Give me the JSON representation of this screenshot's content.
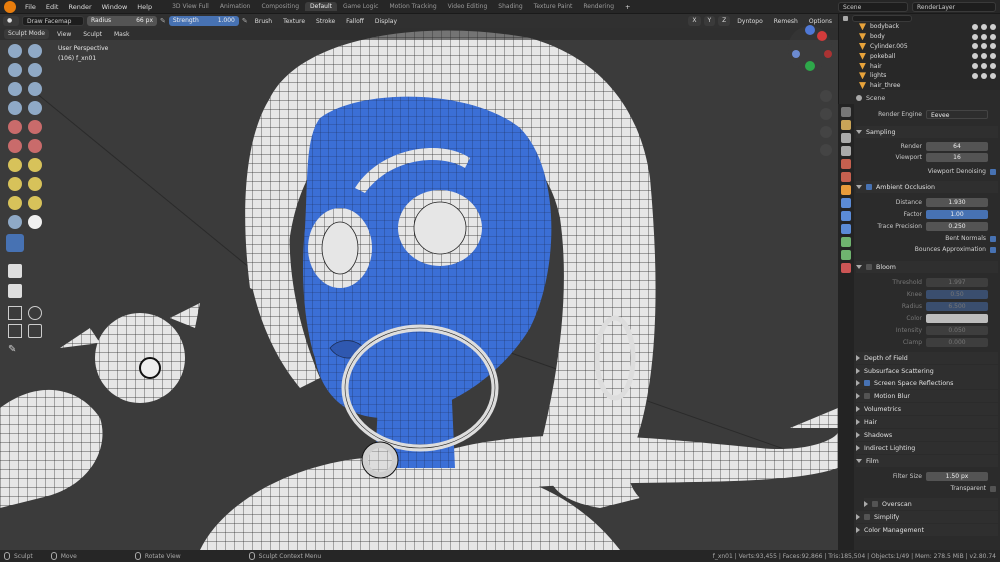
{
  "menu": [
    "File",
    "Edit",
    "Render",
    "Window",
    "Help"
  ],
  "workspaces": [
    "3D View Full",
    "Animation",
    "Compositing",
    "Default",
    "Game Logic",
    "Motion Tracking",
    "Video Editing",
    "Shading",
    "Texture Paint",
    "Rendering"
  ],
  "active_workspace": "Default",
  "scene_label": "Scene",
  "renderlayer_label": "RenderLayer",
  "tool_header": {
    "brush_name": "Draw Facemap",
    "radius_label": "Radius",
    "radius_value": "66 px",
    "strength_label": "Strength",
    "strength_value": "1.000",
    "menus": [
      "Brush",
      "Texture",
      "Stroke",
      "Falloff",
      "Display"
    ],
    "dyntopo": "Dyntopo",
    "remesh": "Remesh",
    "options": "Options"
  },
  "viewport_header": {
    "mode": "Sculpt Mode",
    "menus": [
      "View",
      "Sculpt",
      "Mask"
    ]
  },
  "viewport_overlay": {
    "line1": "User Perspective",
    "line2": "(106) f_xn01"
  },
  "outliner": {
    "rows": [
      "bodyback",
      "body",
      "Cylinder.005",
      "pokeball",
      "hair",
      "lights",
      "hair_three"
    ]
  },
  "properties": {
    "scene": "Scene",
    "render_engine_label": "Render Engine",
    "render_engine": "Eevee",
    "sampling": {
      "title": "Sampling",
      "render_label": "Render",
      "render_value": "64",
      "viewport_label": "Viewport",
      "viewport_value": "16",
      "denoise_label": "Viewport Denoising"
    },
    "ao": {
      "title": "Ambient Occlusion",
      "distance_label": "Distance",
      "distance_value": "1.930",
      "factor_label": "Factor",
      "factor_value": "1.00",
      "trace_label": "Trace Precision",
      "trace_value": "0.250",
      "bent_label": "Bent Normals",
      "bounces_label": "Bounces Approximation"
    },
    "bloom": {
      "title": "Bloom",
      "threshold_label": "Threshold",
      "threshold_value": "1.997",
      "knee_label": "Knee",
      "knee_value": "0.50",
      "radius_label": "Radius",
      "radius_value": "6.500",
      "color_label": "Color",
      "intensity_label": "Intensity",
      "intensity_value": "0.050",
      "clamp_label": "Clamp",
      "clamp_value": "0.000"
    },
    "panels": [
      "Depth of Field",
      "Subsurface Scattering",
      "Screen Space Reflections",
      "Motion Blur",
      "Volumetrics",
      "Hair",
      "Shadows",
      "Indirect Lighting",
      "Film"
    ],
    "film": {
      "filter_label": "Filter Size",
      "filter_value": "1.50 px",
      "transparent_label": "Transparent",
      "overscan_label": "Overscan"
    },
    "bottom_panels": [
      "Simplify",
      "Color Management"
    ]
  },
  "status_bar": {
    "sculpt": "Sculpt",
    "move": "Move",
    "rotate": "Rotate View",
    "context": "Sculpt Context Menu",
    "stats": "f_xn01 | Verts:93,455 | Faces:92,866 | Tris:185,504 | Objects:1/49 | Mem: 278.5 MiB | v2.80.74"
  },
  "colors": {
    "accent": "#4772b3",
    "orange": "#e87d0d",
    "face_blue": "#3b6fd6",
    "mesh_white": "#e8e8e8"
  }
}
